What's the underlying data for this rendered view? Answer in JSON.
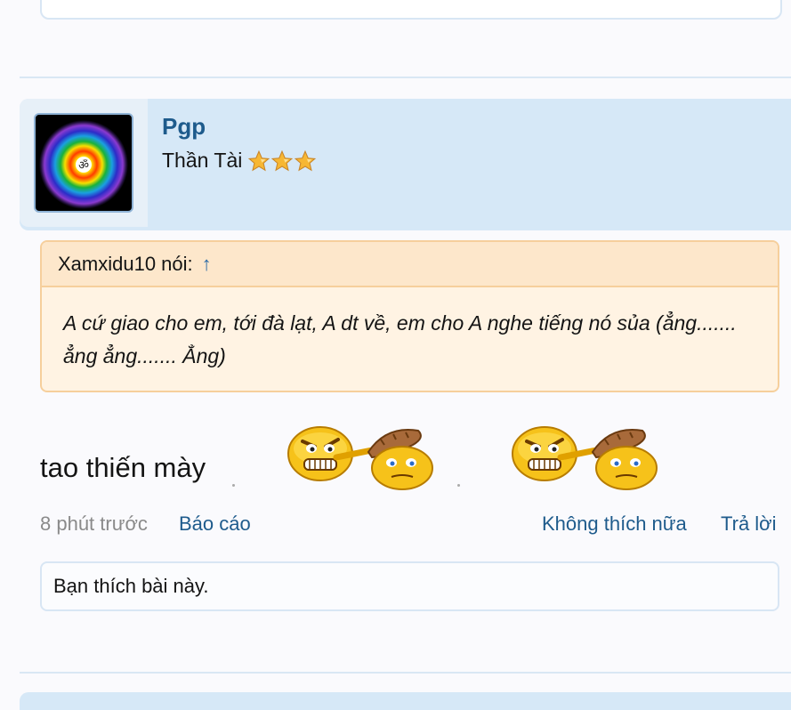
{
  "post": {
    "username": "Pgp",
    "user_title": "Thần Tài",
    "star_count": 3,
    "quote": {
      "author_line": "Xamxidu10 nói:",
      "arrow": "↑",
      "text": "A cứ giao cho em, tới đà lạt, A dt về, em cho A nghe tiếng nó sủa (ẳng....... ẳng ẳng....... Ẳng)"
    },
    "message": "tao thiến mày",
    "time": "8 phút trước",
    "report_label": "Báo cáo",
    "unlike_label": "Không thích nữa",
    "reply_label": "Trả lời",
    "likes_text": "Bạn thích bài này."
  },
  "colors": {
    "link": "#1e5b8c",
    "header_bg": "#d6e8f7",
    "quote_bg": "#fff3e3",
    "quote_border": "#f6cf9c"
  },
  "icons": {
    "avatar": "om-rainbow-icon",
    "star": "star-icon",
    "smiley": "club-smiley-icon"
  }
}
